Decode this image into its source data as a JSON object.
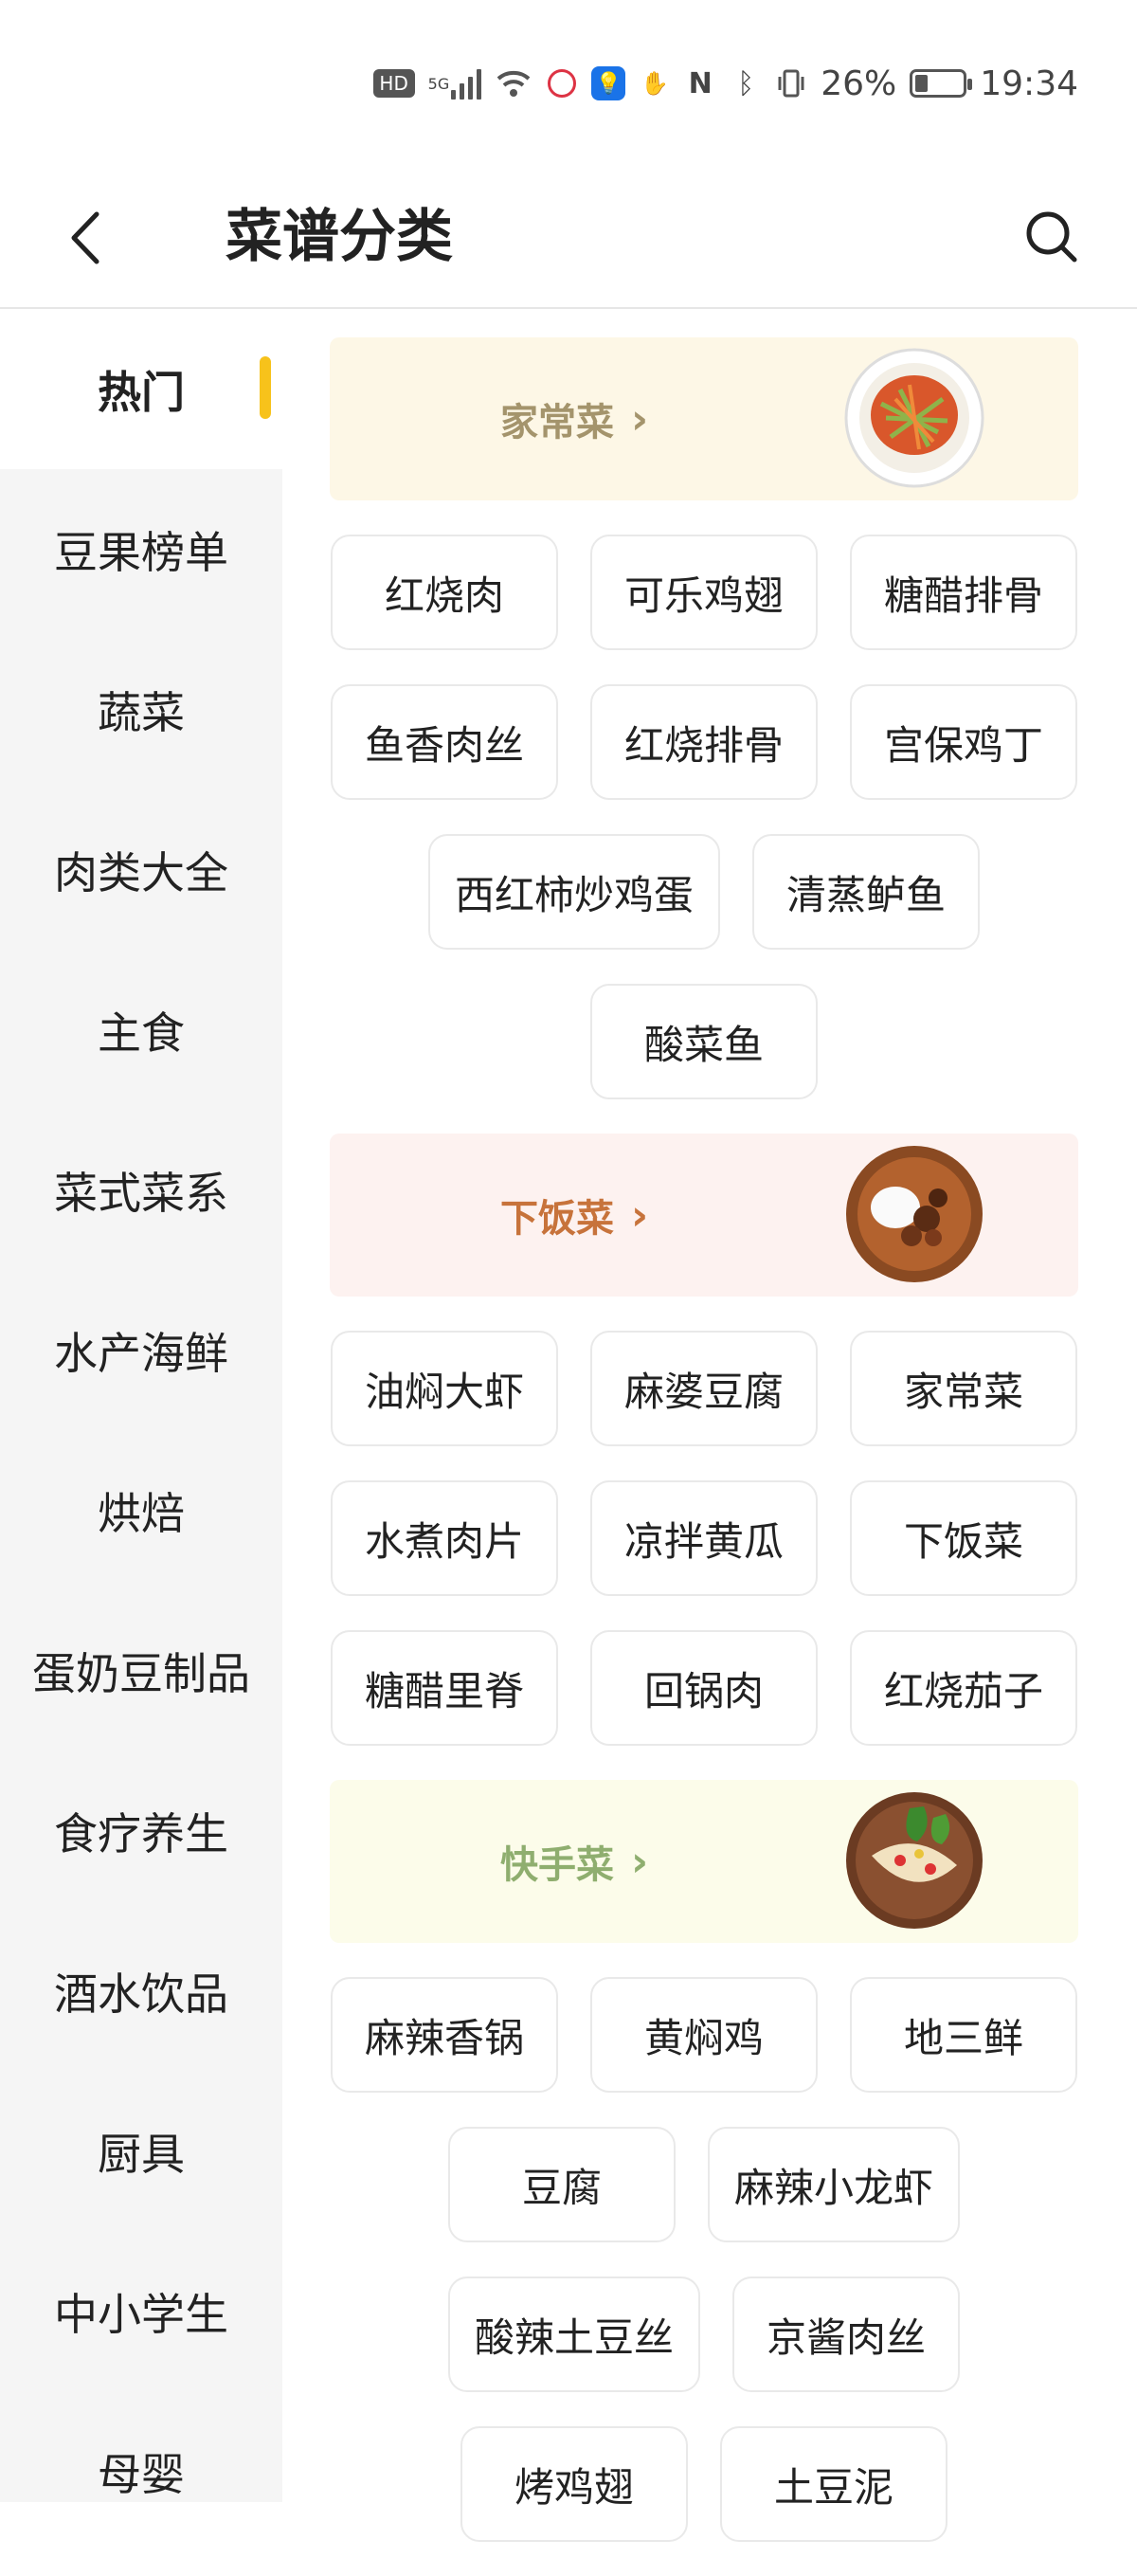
{
  "status_bar": {
    "hd": "HD",
    "network": "5G",
    "battery_percent": "26%",
    "time": "19:34"
  },
  "header": {
    "title": "菜谱分类"
  },
  "sidebar": {
    "items": [
      {
        "label": "热门",
        "active": true
      },
      {
        "label": "豆果榜单"
      },
      {
        "label": "蔬菜"
      },
      {
        "label": "肉类大全"
      },
      {
        "label": "主食"
      },
      {
        "label": "菜式菜系"
      },
      {
        "label": "水产海鲜"
      },
      {
        "label": "烘焙"
      },
      {
        "label": "蛋奶豆制品"
      },
      {
        "label": "食疗养生"
      },
      {
        "label": "酒水饮品"
      },
      {
        "label": "厨具"
      },
      {
        "label": "中小学生"
      },
      {
        "label": "母婴"
      }
    ]
  },
  "sections": [
    {
      "title": "家常菜",
      "bg": "#fdf7e6",
      "color": "#a4946c",
      "image": "stir-fry-plate",
      "tags": [
        "红烧肉",
        "可乐鸡翅",
        "糖醋排骨",
        "鱼香肉丝",
        "红烧排骨",
        "宫保鸡丁",
        "西红柿炒鸡蛋",
        "清蒸鲈鱼",
        "酸菜鱼"
      ]
    },
    {
      "title": "下饭菜",
      "bg": "#fdf2f0",
      "color": "#c7733b",
      "image": "curry-rice-bowl",
      "tags": [
        "油焖大虾",
        "麻婆豆腐",
        "家常菜",
        "水煮肉片",
        "凉拌黄瓜",
        "下饭菜",
        "糖醋里脊",
        "回锅肉",
        "红烧茄子"
      ]
    },
    {
      "title": "快手菜",
      "bg": "#fcfcea",
      "color": "#8fae6f",
      "image": "taco-plate",
      "tags": [
        "麻辣香锅",
        "黄焖鸡",
        "地三鲜",
        "豆腐",
        "麻辣小龙虾",
        "酸辣土豆丝",
        "京酱肉丝",
        "烤鸡翅",
        "土豆泥"
      ]
    }
  ]
}
